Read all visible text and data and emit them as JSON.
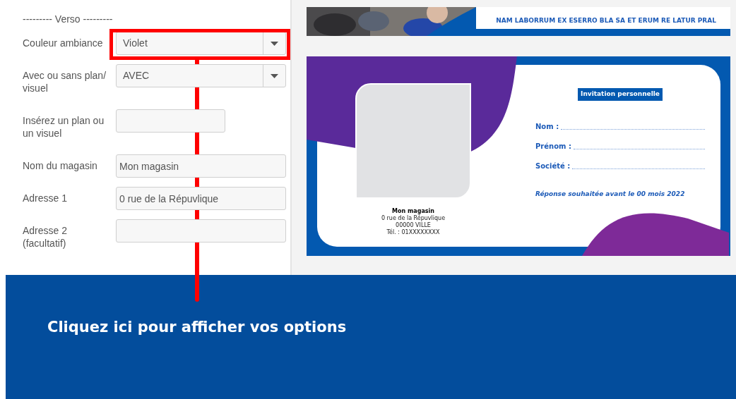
{
  "form": {
    "section_title": "--------- Verso ---------",
    "fields": [
      {
        "kind": "select",
        "label": "Couleur ambiance",
        "value": "Violet",
        "highlighted": true
      },
      {
        "kind": "select",
        "label": "Avec ou sans plan/ visuel",
        "value": "AVEC",
        "highlighted": false
      },
      {
        "kind": "upload",
        "label": "Insérez un plan ou un visuel",
        "highlighted": false
      },
      {
        "kind": "text",
        "label": "Nom du magasin",
        "value": "Mon magasin",
        "highlighted": false
      },
      {
        "kind": "text",
        "label": "Adresse 1",
        "value": "0 rue de la Répuvlique",
        "highlighted": false
      },
      {
        "kind": "text",
        "label": "Adresse 2 (facultatif)",
        "highlighted": false
      }
    ]
  },
  "preview": {
    "top_card": {
      "text": "NAM LABORRUM EX ESERRO BLA SA ET ERUM RE LATUR PRAL"
    },
    "invitation_card": {
      "store_name": "Mon magasin",
      "address_lines": [
        "0 rue de la Répuvlique",
        "00000 VILLE",
        "Tél. : 01XXXXXXXX"
      ],
      "title": "Invitation personnelle",
      "form_lines": [
        "Nom :",
        "Prénom :",
        "Société :"
      ],
      "reply_note": "Réponse souhaitée avant le 00 mois 2022"
    }
  },
  "banner": {
    "text": "Cliquez ici pour afficher vos options"
  }
}
